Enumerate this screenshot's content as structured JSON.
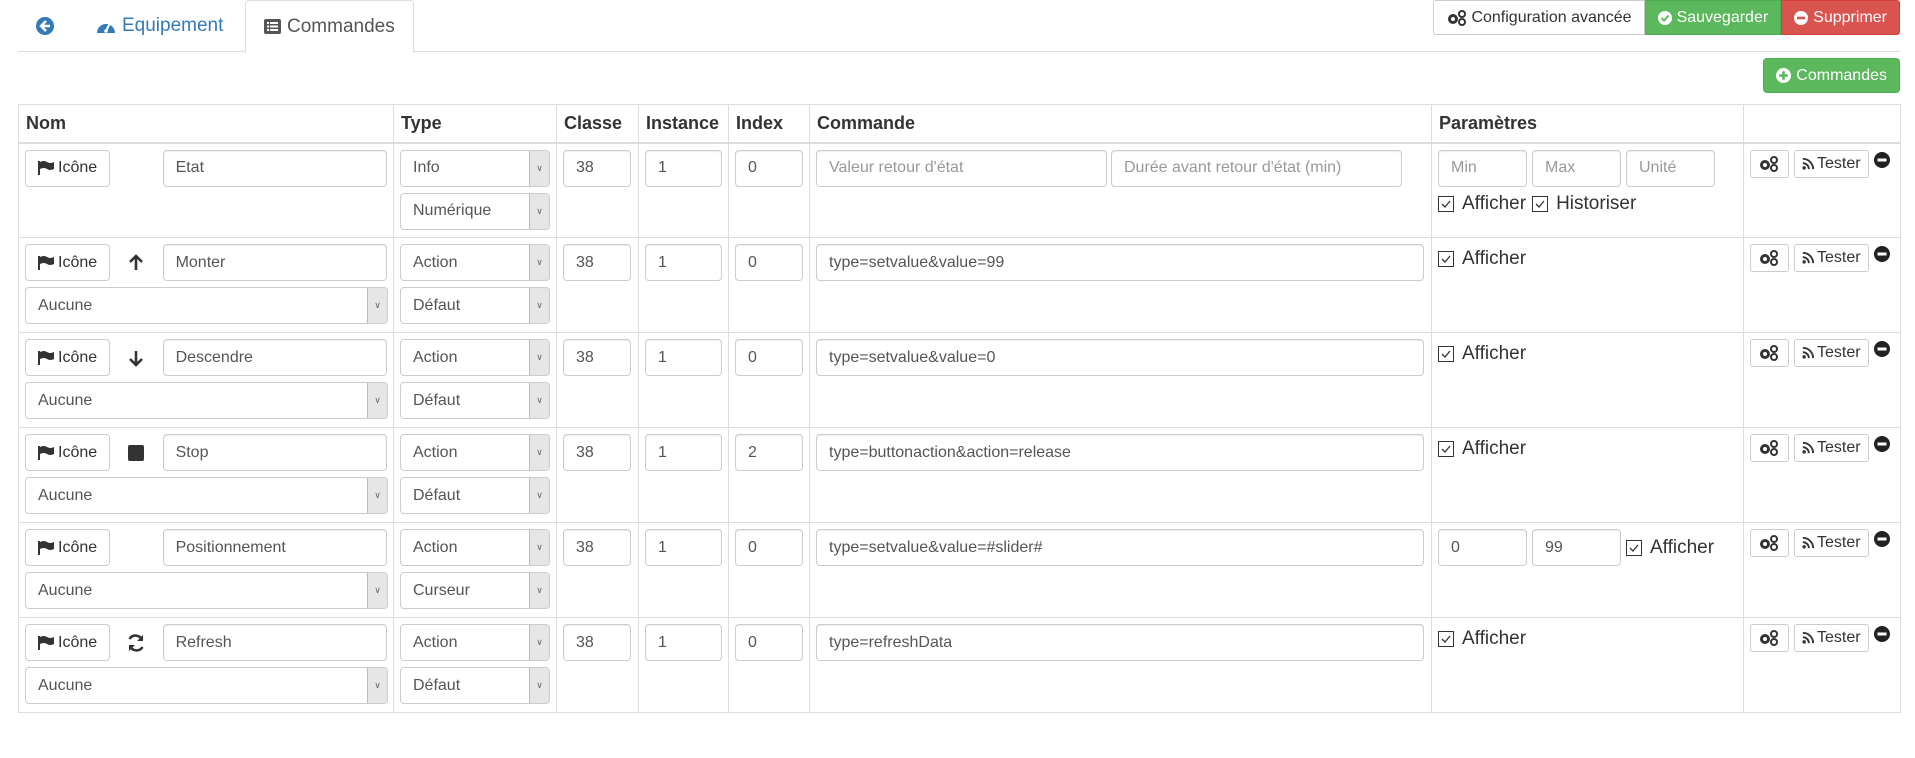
{
  "tabs": {
    "back_icon": "arrow-circle-left-icon",
    "equipement": {
      "label": "Equipement",
      "icon": "tachometer-icon"
    },
    "commandes": {
      "label": "Commandes",
      "icon": "list-alt-icon"
    }
  },
  "toolbar": {
    "config_label": "Configuration avancée",
    "save_label": "Sauvegarder",
    "delete_label": "Supprimer",
    "add_commands_label": "Commandes"
  },
  "colors": {
    "link": "#337ab7",
    "success": "#5cb85c",
    "danger": "#d9534f"
  },
  "table": {
    "headers": {
      "nom": "Nom",
      "type": "Type",
      "classe": "Classe",
      "instance": "Instance",
      "index": "Index",
      "commande": "Commande",
      "parametres": "Paramètres"
    },
    "icon_button_label": "Icône",
    "tester_label": "Tester",
    "rows": [
      {
        "name": "Etat",
        "cmd_icon": "",
        "type": "Info",
        "subtype": "Numérique",
        "classe": "38",
        "instance": "1",
        "index": "0",
        "valeur_retour_placeholder": "Valeur retour d'état",
        "duree_placeholder": "Durée avant retour d'état (min)",
        "min_placeholder": "Min",
        "max_placeholder": "Max",
        "unite_placeholder": "Unité",
        "afficher": "Afficher",
        "historiser": "Historiser"
      },
      {
        "name": "Monter",
        "cmd_icon": "arrow-up-icon",
        "value_link": "Aucune",
        "type": "Action",
        "subtype": "Défaut",
        "classe": "38",
        "instance": "1",
        "index": "0",
        "commande": "type=setvalue&value=99",
        "afficher": "Afficher"
      },
      {
        "name": "Descendre",
        "cmd_icon": "arrow-down-icon",
        "value_link": "Aucune",
        "type": "Action",
        "subtype": "Défaut",
        "classe": "38",
        "instance": "1",
        "index": "0",
        "commande": "type=setvalue&value=0",
        "afficher": "Afficher"
      },
      {
        "name": "Stop",
        "cmd_icon": "stop-icon",
        "value_link": "Aucune",
        "type": "Action",
        "subtype": "Défaut",
        "classe": "38",
        "instance": "1",
        "index": "2",
        "commande": "type=buttonaction&action=release",
        "afficher": "Afficher"
      },
      {
        "name": "Positionnement",
        "cmd_icon": "",
        "value_link": "Aucune",
        "type": "Action",
        "subtype": "Curseur",
        "classe": "38",
        "instance": "1",
        "index": "0",
        "commande": "type=setvalue&value=#slider#",
        "min": "0",
        "max": "99",
        "afficher": "Afficher"
      },
      {
        "name": "Refresh",
        "cmd_icon": "refresh-icon",
        "value_link": "Aucune",
        "type": "Action",
        "subtype": "Défaut",
        "classe": "38",
        "instance": "1",
        "index": "0",
        "commande": "type=refreshData",
        "afficher": "Afficher"
      }
    ]
  }
}
